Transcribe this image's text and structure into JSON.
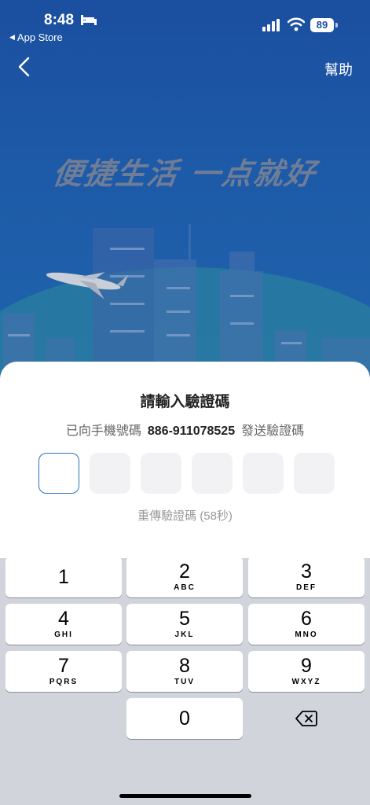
{
  "status_bar": {
    "time": "8:48",
    "back_app": "App Store",
    "battery": "89"
  },
  "nav": {
    "help": "幫助"
  },
  "hero": {
    "slogan": "便捷生活 一点就好"
  },
  "sheet": {
    "title": "請輸入驗證碼",
    "sub_prefix": "已向手機號碼",
    "phone": "886-911078525",
    "sub_suffix": "發送驗證碼",
    "otp_length": 6,
    "resend": "重傳驗證碼 (58秒)"
  },
  "keypad": {
    "keys": [
      {
        "num": "1",
        "letters": ""
      },
      {
        "num": "2",
        "letters": "ABC"
      },
      {
        "num": "3",
        "letters": "DEF"
      },
      {
        "num": "4",
        "letters": "GHI"
      },
      {
        "num": "5",
        "letters": "JKL"
      },
      {
        "num": "6",
        "letters": "MNO"
      },
      {
        "num": "7",
        "letters": "PQRS"
      },
      {
        "num": "8",
        "letters": "TUV"
      },
      {
        "num": "9",
        "letters": "WXYZ"
      },
      {
        "num": "0",
        "letters": ""
      }
    ],
    "delete_icon": "delete-backspace-icon"
  }
}
